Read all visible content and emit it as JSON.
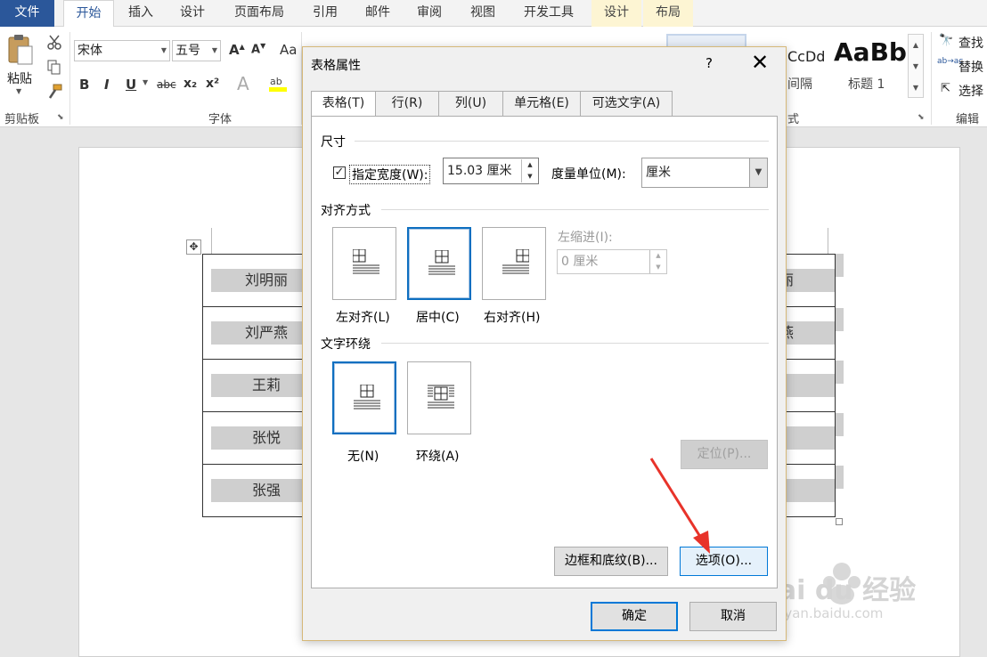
{
  "ribbon": {
    "tabs": [
      "文件",
      "开始",
      "插入",
      "设计",
      "页面布局",
      "引用",
      "邮件",
      "审阅",
      "视图",
      "开发工具",
      "设计",
      "布局"
    ],
    "font_name": "宋体",
    "font_size": "五号",
    "paste_label": "粘贴",
    "clipboard_label": "剪贴板",
    "font_group_label": "字体",
    "style_preview_1": "CcDd",
    "style_preview_1_name": "间隔",
    "style_preview_2": "AaBb",
    "style_preview_2_name": "标题 1",
    "styles_group_label": "式",
    "find_label": "查找",
    "replace_label": "替换",
    "select_label": "选择",
    "edit_group_label": "编辑",
    "bold": "B",
    "italic": "I",
    "underline": "U",
    "strike": "abc",
    "sub": "x₂",
    "sup": "x²",
    "aa": "Aa"
  },
  "table": {
    "rows": [
      {
        "left": "刘明丽",
        "right": "丽"
      },
      {
        "left": "刘严燕",
        "right": "燕"
      },
      {
        "left": "王莉",
        "right": ""
      },
      {
        "left": "张悦",
        "right": ""
      },
      {
        "left": "张强",
        "right": ""
      }
    ]
  },
  "dialog": {
    "title": "表格属性",
    "help": "?",
    "close": "✕",
    "tabs": [
      "表格(T)",
      "行(R)",
      "列(U)",
      "单元格(E)",
      "可选文字(A)"
    ],
    "size_section": "尺寸",
    "specify_width_label": "指定宽度(W):",
    "width_value": "15.03 厘米",
    "measure_label": "度量单位(M):",
    "measure_value": "厘米",
    "alignment_section": "对齐方式",
    "align_left": "左对齐(L)",
    "align_center": "居中(C)",
    "align_right": "右对齐(H)",
    "indent_label": "左缩进(I):",
    "indent_value": "0 厘米",
    "wrap_section": "文字环绕",
    "wrap_none": "无(N)",
    "wrap_around": "环绕(A)",
    "position_button": "定位(P)...",
    "borders_button": "边框和底纹(B)...",
    "options_button": "选项(O)...",
    "ok_button": "确定",
    "cancel_button": "取消"
  },
  "watermark": {
    "brand": "Bai du 经验",
    "url": "jingyan.baidu.com"
  },
  "colors": {
    "accent": "#2b579a",
    "selection_blue": "#0e6fc0",
    "arrow_red": "#e8332a"
  }
}
